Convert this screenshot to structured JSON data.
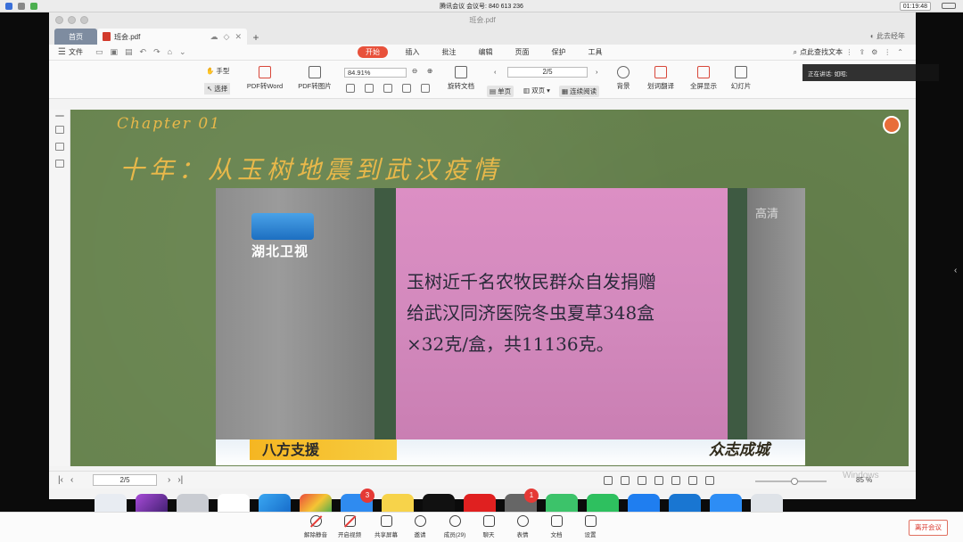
{
  "system_bar": {
    "meeting_title": "腾讯会议",
    "meeting_id_label": "会议号: 840 613 236",
    "clock": "01:19:48"
  },
  "window": {
    "title": "班会.pdf"
  },
  "tabs": {
    "home": "首页",
    "file": "班会.pdf",
    "add": "+",
    "right_label": "此去经年"
  },
  "menubar": {
    "file": "文件",
    "menus": [
      "开始",
      "插入",
      "批注",
      "编辑",
      "页面",
      "保护",
      "工具"
    ],
    "active": "开始",
    "search": "点此查找文本"
  },
  "toolbar": {
    "hand": "手型",
    "select": "选择",
    "pdf_to_word": "PDF转Word",
    "pdf_to_image": "PDF转图片",
    "zoom": "84.91%",
    "page": "2/5",
    "rotate": "旋转文档",
    "single_page": "单页",
    "double_page": "双页",
    "continuous": "连续阅读",
    "background": "背景",
    "translate": "划词翻译",
    "fullscreen": "全屏显示",
    "slideshow": "幻灯片"
  },
  "slide": {
    "chapter": "Chapter 01",
    "title": "十年：从玉树地震到武汉疫情",
    "video": {
      "channel_logo": "湖北卫视",
      "hd_label": "高清",
      "paper_lines": [
        "玉树近千名农牧民群众自发捐赠",
        "给武汉同济医院冬虫夏草348盒",
        "×32克/盒，共11136克。"
      ],
      "ticker_label": "八方支援",
      "ticker_right": "众志成城"
    }
  },
  "statusbar": {
    "page": "2/5",
    "zoom": "85 %",
    "watermark": "Windows"
  },
  "dock": {
    "badges": [
      "3",
      "1"
    ]
  },
  "meeting": {
    "speaking": "正在讲话: 如昭;",
    "controls": [
      "解除静音",
      "开启视频",
      "共享屏幕",
      "邀请",
      "成员(29)",
      "聊天",
      "表情",
      "文档",
      "设置"
    ],
    "leave": "离开会议"
  },
  "colors": {
    "accent": "#e8513b",
    "slide_bg": "#67834e",
    "slide_text": "#e8b84a",
    "ticker_yellow": "#f5b622",
    "paper_pink": "#d389bd"
  }
}
